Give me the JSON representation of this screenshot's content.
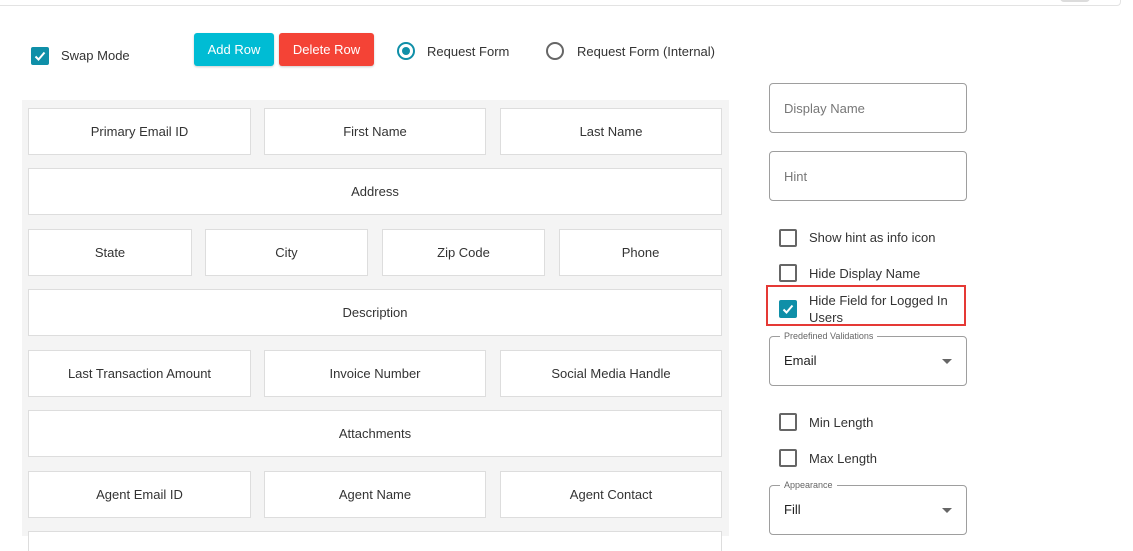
{
  "toolbar": {
    "swap_mode_label": "Swap Mode",
    "swap_mode_checked": true,
    "add_row_label": "Add Row",
    "delete_row_label": "Delete Row",
    "form_type_options": [
      "Request Form",
      "Request Form (Internal)"
    ],
    "form_type_selected": "Request Form"
  },
  "form_grid": {
    "rows": [
      [
        "Primary Email ID",
        "First Name",
        "Last Name"
      ],
      [
        "Address"
      ],
      [
        "State",
        "City",
        "Zip Code",
        "Phone"
      ],
      [
        "Description"
      ],
      [
        "Last Transaction Amount",
        "Invoice Number",
        "Social Media Handle"
      ],
      [
        "Attachments"
      ],
      [
        "Agent Email ID",
        "Agent Name",
        "Agent Contact"
      ]
    ]
  },
  "properties": {
    "display_name_placeholder": "Display Name",
    "hint_placeholder": "Hint",
    "show_hint_info_icon_label": "Show hint as info icon",
    "show_hint_info_icon_checked": false,
    "hide_display_name_label": "Hide Display Name",
    "hide_display_name_checked": false,
    "hide_field_logged_in_label_line1": "Hide Field for Logged In",
    "hide_field_logged_in_label_line2": "Users",
    "hide_field_logged_in_checked": true,
    "predefined_validations_legend": "Predefined Validations",
    "predefined_validations_value": "Email",
    "min_length_label": "Min Length",
    "min_length_checked": false,
    "max_length_label": "Max Length",
    "max_length_checked": false,
    "appearance_legend": "Appearance",
    "appearance_value": "Fill"
  },
  "colors": {
    "accent": "#0f8fa8",
    "add_button": "#00bcd4",
    "delete_button": "#f44336",
    "highlight_border": "#e53935"
  }
}
